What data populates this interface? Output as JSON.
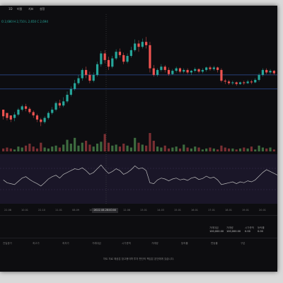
{
  "toolbar": {
    "item1": "1D",
    "item2": "비율",
    "item3": "지표",
    "item4": "설정"
  },
  "ohlc": "O 2,680  H 2,710  L 2,650  C 2,694",
  "time_axis": {
    "labels": [
      "22.08",
      "10.01",
      "22.10",
      "11.01",
      "08.09",
      "10.03",
      "11.12",
      "12.08",
      "13.01",
      "14.03",
      "15.01",
      "16.01",
      "17.01",
      "18.01",
      "19.01",
      "20.01"
    ],
    "cursor_label": "2022.08.28 00:00"
  },
  "stats": [
    {
      "label": "거래대금",
      "value": "100,000.00"
    },
    {
      "label": "거래량",
      "value": "100,000.00"
    },
    {
      "label": "시가총액",
      "value": "0.00"
    },
    {
      "label": "등락률",
      "value": "0.00"
    }
  ],
  "bottom_labels": [
    "전일종가",
    "최고가",
    "최저가",
    "거래대금",
    "시가총액",
    "거래량",
    "등락률",
    "변동률",
    "구분"
  ],
  "footer_note": "차트 자료 제공은 참고용이며 투자 판단의 책임은 본인에게 있습니다.",
  "colors": {
    "up": "#26a69a",
    "down": "#ef5350",
    "volume_up": "#3d6b3f",
    "volume_down": "#7a2f33",
    "hline": "#2f4f9a",
    "rsi": "#bbbbbb",
    "rsi_bg": "#1a1628"
  },
  "chart_data": {
    "type": "candlestick",
    "candles": [
      [
        70,
        62,
        58,
        66
      ],
      [
        66,
        60,
        57,
        63
      ],
      [
        63,
        58,
        55,
        60
      ],
      [
        60,
        64,
        67,
        56
      ],
      [
        64,
        70,
        72,
        62
      ],
      [
        70,
        74,
        76,
        68
      ],
      [
        74,
        71,
        68,
        77
      ],
      [
        71,
        67,
        65,
        73
      ],
      [
        67,
        63,
        60,
        69
      ],
      [
        63,
        58,
        55,
        65
      ],
      [
        58,
        55,
        50,
        60
      ],
      [
        55,
        60,
        62,
        53
      ],
      [
        60,
        66,
        68,
        58
      ],
      [
        66,
        70,
        73,
        64
      ],
      [
        70,
        78,
        80,
        68
      ],
      [
        78,
        75,
        72,
        82
      ],
      [
        75,
        80,
        85,
        73
      ],
      [
        80,
        88,
        92,
        78
      ],
      [
        88,
        95,
        98,
        86
      ],
      [
        95,
        102,
        106,
        93
      ],
      [
        102,
        108,
        112,
        100
      ],
      [
        108,
        118,
        120,
        105
      ],
      [
        118,
        112,
        108,
        122
      ],
      [
        112,
        105,
        102,
        116
      ],
      [
        105,
        112,
        115,
        103
      ],
      [
        112,
        125,
        128,
        110
      ],
      [
        125,
        138,
        141,
        122
      ],
      [
        138,
        130,
        126,
        142
      ],
      [
        130,
        122,
        118,
        134
      ],
      [
        122,
        132,
        135,
        120
      ],
      [
        132,
        140,
        143,
        130
      ],
      [
        140,
        136,
        133,
        144
      ],
      [
        136,
        128,
        125,
        139
      ],
      [
        128,
        135,
        138,
        126
      ],
      [
        135,
        142,
        146,
        133
      ],
      [
        142,
        150,
        155,
        140
      ],
      [
        150,
        146,
        140,
        154
      ],
      [
        146,
        152,
        156,
        144
      ],
      [
        152,
        148,
        144,
        158
      ],
      [
        148,
        120,
        115,
        152
      ],
      [
        120,
        112,
        110,
        124
      ],
      [
        112,
        118,
        120,
        110
      ],
      [
        118,
        122,
        125,
        116
      ],
      [
        122,
        118,
        115,
        124
      ],
      [
        118,
        113,
        111,
        121
      ],
      [
        113,
        117,
        119,
        112
      ],
      [
        117,
        120,
        122,
        115
      ],
      [
        120,
        116,
        114,
        121
      ],
      [
        116,
        118,
        120,
        114
      ],
      [
        118,
        115,
        113,
        120
      ],
      [
        115,
        117,
        118,
        112
      ],
      [
        117,
        119,
        121,
        115
      ],
      [
        119,
        116,
        114,
        120
      ],
      [
        116,
        118,
        120,
        114
      ],
      [
        118,
        121,
        122,
        116
      ],
      [
        121,
        119,
        117,
        123
      ],
      [
        119,
        121,
        123,
        117
      ],
      [
        121,
        118,
        115,
        122
      ],
      [
        118,
        105,
        103,
        120
      ],
      [
        105,
        104,
        101,
        107
      ],
      [
        104,
        102,
        100,
        106
      ],
      [
        102,
        103,
        105,
        100
      ],
      [
        103,
        101,
        99,
        104
      ],
      [
        101,
        103,
        104,
        100
      ],
      [
        103,
        102,
        100,
        105
      ],
      [
        102,
        104,
        106,
        101
      ],
      [
        104,
        103,
        101,
        106
      ],
      [
        103,
        106,
        108,
        102
      ],
      [
        106,
        112,
        114,
        104
      ],
      [
        112,
        118,
        120,
        110
      ],
      [
        118,
        115,
        113,
        120
      ],
      [
        115,
        117,
        119,
        113
      ],
      [
        117,
        114,
        112,
        118
      ]
    ],
    "volume": [
      3,
      4,
      3,
      2,
      5,
      4,
      6,
      8,
      5,
      3,
      9,
      4,
      3,
      5,
      6,
      4,
      7,
      12,
      8,
      14,
      6,
      9,
      11,
      7,
      5,
      8,
      10,
      18,
      9,
      6,
      7,
      5,
      8,
      6,
      4,
      14,
      9,
      7,
      6,
      19,
      11,
      5,
      4,
      6,
      3,
      4,
      5,
      3,
      7,
      4,
      3,
      5,
      4,
      2,
      3,
      4,
      3,
      2,
      6,
      4,
      3,
      3,
      2,
      3,
      4,
      3,
      5,
      2,
      6,
      4,
      3,
      4,
      2
    ],
    "rsi": [
      48,
      42,
      40,
      38,
      45,
      52,
      55,
      49,
      44,
      40,
      35,
      42,
      50,
      55,
      58,
      52,
      60,
      64,
      68,
      72,
      70,
      74,
      68,
      60,
      64,
      72,
      80,
      70,
      62,
      66,
      72,
      68,
      60,
      64,
      70,
      78,
      72,
      74,
      68,
      42,
      40,
      48,
      52,
      50,
      46,
      50,
      52,
      48,
      50,
      47,
      52,
      54,
      49,
      51,
      56,
      52,
      54,
      48,
      38,
      40,
      42,
      44,
      40,
      44,
      42,
      46,
      44,
      48,
      56,
      64,
      70,
      66,
      62,
      58
    ],
    "hlines": [
      112,
      95
    ]
  }
}
